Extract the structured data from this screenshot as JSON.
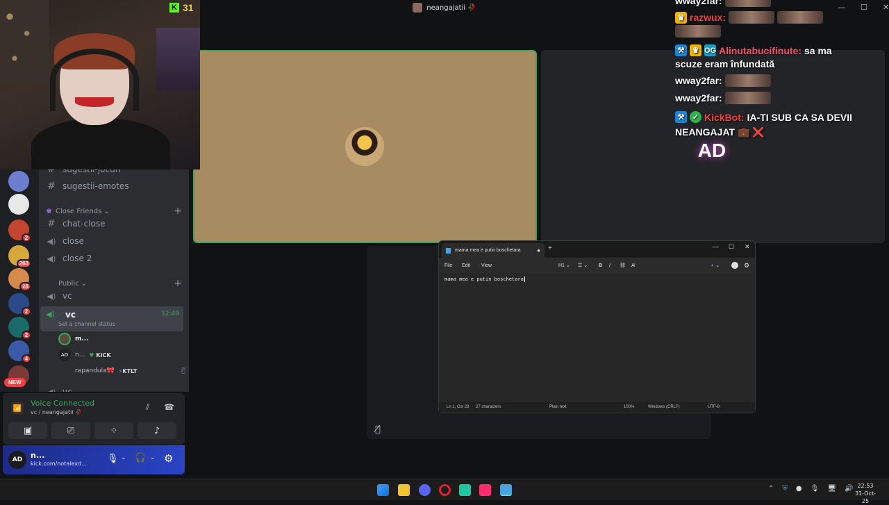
{
  "webcam": {
    "kick_count": "31"
  },
  "stage": {
    "title": "neangajatii 🥀"
  },
  "servers": [
    {
      "badge": ""
    },
    {
      "badge": ""
    },
    {
      "badge": "2"
    },
    {
      "badge": "263"
    },
    {
      "badge": "28"
    },
    {
      "badge": "2"
    },
    {
      "badge": "2"
    },
    {
      "badge": "4"
    },
    {
      "badge": ""
    }
  ],
  "new_label": "NEW",
  "channels": {
    "top_partial": "sugestii-jocuri",
    "emotes": "sugestii-emotes",
    "cat_close": "Close Friends",
    "chat_close": "chat-close",
    "close": "close",
    "close2": "close 2",
    "cat_public": "Public",
    "vc1": "vc",
    "vc_active": "vc",
    "vc_time": "12:49",
    "vc_status": "Set a channel status",
    "members": [
      {
        "name": "m...",
        "tag": ""
      },
      {
        "name": "n...",
        "tag": "KICK"
      },
      {
        "name": "rapandula🎀",
        "tag": "KTLT"
      }
    ],
    "bottom_partial": "vc"
  },
  "voice": {
    "status": "Voice Connected",
    "location": "vc / neangajatii 🥀"
  },
  "user": {
    "name": "n...",
    "sub": "kick.com/notalexd..."
  },
  "chat": [
    {
      "user": "wway2far:",
      "color": "#ffffff",
      "text": ""
    },
    {
      "user": "razwux:",
      "color": "#ff3b3b",
      "text": ""
    },
    {
      "user": "Alinutabucifinute:",
      "color": "#ff4d6d",
      "text": "sa ma"
    },
    {
      "user": "",
      "color": "#ffffff",
      "text": "scuze eram înfundată"
    },
    {
      "user": "wway2far:",
      "color": "#ffffff",
      "text": ""
    },
    {
      "user": "wway2far:",
      "color": "#ffffff",
      "text": ""
    },
    {
      "user": "KickBot:",
      "color": "#ff3b3b",
      "text": "IA-TI SUB CA SA DEVII"
    },
    {
      "user": "",
      "color": "#ffffff",
      "text": "NEANGAJAT 💼 ❌"
    }
  ],
  "chat_icon_text": "AD",
  "notepad": {
    "tab_title": "mama mea e putin boschetara",
    "menu": [
      "File",
      "Edit",
      "View"
    ],
    "heading_menu": "H1",
    "content": "mama mea e putin boschetara",
    "status": {
      "position": "Ln 1, Col 28",
      "chars": "27 characters",
      "format": "Plain text",
      "zoom": "100%",
      "eol": "Windows (CRLF)",
      "encoding": "UTF-8"
    }
  },
  "clock": {
    "time": "22:53",
    "date": "31-Oct-25"
  }
}
